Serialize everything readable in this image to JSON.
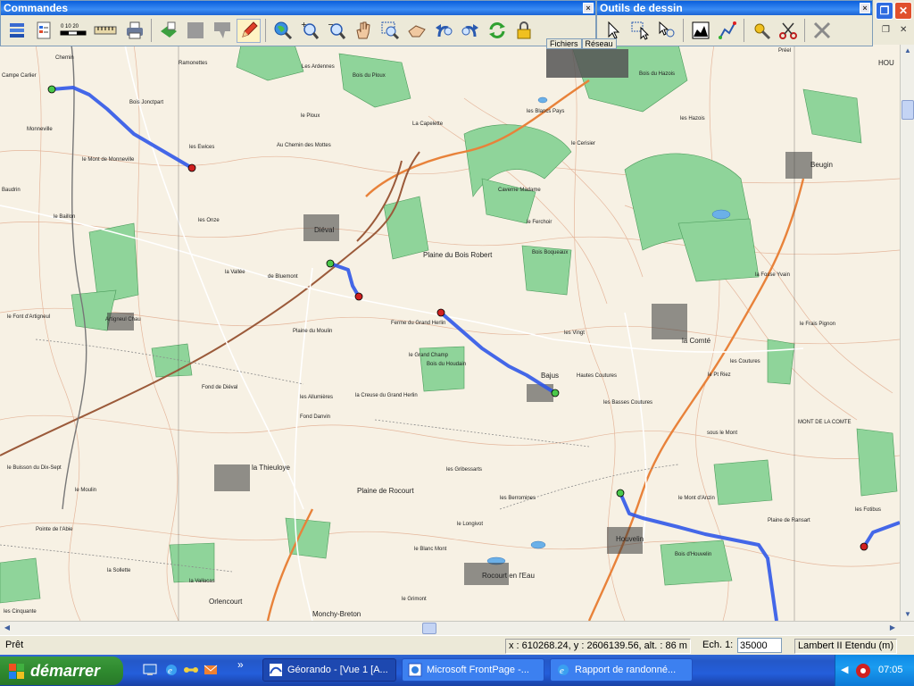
{
  "toolbars": {
    "commands": {
      "title": "Commandes",
      "close": "×",
      "buttons": [
        {
          "icon": "layers-icon"
        },
        {
          "icon": "properties-icon"
        },
        {
          "icon": "scale-icon"
        },
        {
          "icon": "ruler-icon"
        },
        {
          "icon": "print-icon"
        },
        {
          "icon": "import-icon"
        },
        {
          "icon": "gray-square-icon"
        },
        {
          "icon": "gray-shape-icon"
        },
        {
          "icon": "pencil-icon"
        },
        {
          "icon": "globe-zoom-icon"
        },
        {
          "icon": "zoom-in-icon"
        },
        {
          "icon": "zoom-out-icon"
        },
        {
          "icon": "hand-pan-icon"
        },
        {
          "icon": "zoom-window-icon"
        },
        {
          "icon": "hand-drag-icon"
        },
        {
          "icon": "undo-icon"
        },
        {
          "icon": "redo-icon"
        },
        {
          "icon": "refresh-icon"
        },
        {
          "icon": "lock-icon"
        }
      ],
      "scale_ticks": "0  10  20"
    },
    "drawing": {
      "title": "Outils de dessin",
      "close": "×",
      "buttons": [
        {
          "icon": "arrow-cursor-icon"
        },
        {
          "icon": "select-box-icon"
        },
        {
          "icon": "select-magnify-icon"
        },
        {
          "icon": "profile-icon"
        },
        {
          "icon": "polyline-icon"
        },
        {
          "icon": "tools-icon"
        },
        {
          "icon": "scissors-icon"
        },
        {
          "icon": "cross-tool-icon"
        }
      ]
    }
  },
  "tabs": [
    "Fichiers",
    "Réseau"
  ],
  "mdi": {
    "restore": "❐",
    "close": "✕"
  },
  "map": {
    "labels": [
      {
        "t": "Chemin",
        "big": false
      },
      {
        "t": "Ramonettes",
        "big": false
      },
      {
        "t": "Campe Carlier",
        "big": false
      },
      {
        "t": "Les Ardennes",
        "big": false
      },
      {
        "t": "Bois du Ploux",
        "big": false
      },
      {
        "t": "Bois Jonctpart",
        "big": false
      },
      {
        "t": "Monneville",
        "big": false
      },
      {
        "t": "le Ploux",
        "big": false
      },
      {
        "t": "La Capelette",
        "big": false
      },
      {
        "t": "les Blancs Pays",
        "big": false
      },
      {
        "t": "le Cerisier",
        "big": false
      },
      {
        "t": "les Hazois",
        "big": false
      },
      {
        "t": "Bois du Hazois",
        "big": false
      },
      {
        "t": "Préel",
        "big": false
      },
      {
        "t": "le Mont de Monneville",
        "big": false
      },
      {
        "t": "les Ewices",
        "big": false
      },
      {
        "t": "Au Chemin des Mottes",
        "big": false
      },
      {
        "t": "Caverne Madame",
        "big": false
      },
      {
        "t": "Beugin",
        "big": true
      },
      {
        "t": "Baudrin",
        "big": false
      },
      {
        "t": "le Baillon",
        "big": false
      },
      {
        "t": "les Onze",
        "big": false
      },
      {
        "t": "Diéval",
        "big": true
      },
      {
        "t": "le Ferchoir",
        "big": false
      },
      {
        "t": "Plaine du Bois Robert",
        "big": true
      },
      {
        "t": "Bois Boqueaux",
        "big": false
      },
      {
        "t": "la Vallée",
        "big": false
      },
      {
        "t": "de Bluemont",
        "big": false
      },
      {
        "t": "le Font d'Artigneul",
        "big": false
      },
      {
        "t": "Artigneul Chau",
        "big": false
      },
      {
        "t": "Ferme du Grand Herlin",
        "big": false
      },
      {
        "t": "les Vingt",
        "big": false
      },
      {
        "t": "la Comté",
        "big": true
      },
      {
        "t": "la Fosse Yvain",
        "big": false
      },
      {
        "t": "le Frais Pignon",
        "big": false
      },
      {
        "t": "Plaine du Moulin",
        "big": false
      },
      {
        "t": "Bois du Houdain",
        "big": false
      },
      {
        "t": "Bajus",
        "big": true
      },
      {
        "t": "Hautes Coutures",
        "big": false
      },
      {
        "t": "le Pt Riez",
        "big": false
      },
      {
        "t": "les Coutures",
        "big": false
      },
      {
        "t": "le Grand Champ",
        "big": false
      },
      {
        "t": "Fond de Diéval",
        "big": false
      },
      {
        "t": "les Allumières",
        "big": false
      },
      {
        "t": "la Creuse du Grand Herlin",
        "big": false
      },
      {
        "t": "les Basses Coutures",
        "big": false
      },
      {
        "t": "sous le Mont",
        "big": false
      },
      {
        "t": "MONT DE LA COMTE",
        "big": false
      },
      {
        "t": "Fond Danvin",
        "big": false
      },
      {
        "t": "le Buisson du Dix-Sept",
        "big": false
      },
      {
        "t": "la Thieuloye",
        "big": true
      },
      {
        "t": "les Gribessarts",
        "big": false
      },
      {
        "t": "le Moulin",
        "big": false
      },
      {
        "t": "Plaine de Rocourt",
        "big": true
      },
      {
        "t": "les Berromines",
        "big": false
      },
      {
        "t": "le Mont d'Anzin",
        "big": false
      },
      {
        "t": "Plaine de Ransart",
        "big": false
      },
      {
        "t": "Pointe de l'Abie",
        "big": false
      },
      {
        "t": "Houvelin",
        "big": true
      },
      {
        "t": "le Blanc Mont",
        "big": false
      },
      {
        "t": "le Longivot",
        "big": false
      },
      {
        "t": "Bois d'Houvelin",
        "big": false
      },
      {
        "t": "la Sollette",
        "big": false
      },
      {
        "t": "la Vallacas",
        "big": false
      },
      {
        "t": "Rocourt en l'Eau",
        "big": true
      },
      {
        "t": "les Cinquante",
        "big": false
      },
      {
        "t": "Orlencourt",
        "big": true
      },
      {
        "t": "le Grimont",
        "big": false
      },
      {
        "t": "Monchy-Breton",
        "big": true
      },
      {
        "t": "les Fotibus",
        "big": false
      },
      {
        "t": "HOU",
        "big": true
      }
    ]
  },
  "status": {
    "ready": "Prêt",
    "coords": "x : 610268.24, y : 2606139.56, alt. : 86 m",
    "scale_label": "Ech. 1:",
    "scale_value": "35000",
    "projection": "Lambert II Etendu (m)"
  },
  "taskbar": {
    "start": "démarrer",
    "quick_launch": [
      "desktop-icon",
      "ie-icon",
      "network-icon",
      "mail-icon"
    ],
    "chevron": "»",
    "tasks": [
      {
        "label": "Géorando - [Vue 1 [A...",
        "icon": "georando-icon",
        "active": true
      },
      {
        "label": "Microsoft FrontPage -...",
        "icon": "frontpage-icon",
        "active": false
      },
      {
        "label": "Rapport de randonné...",
        "icon": "ie-icon",
        "active": false
      }
    ],
    "clock": "07:05"
  }
}
